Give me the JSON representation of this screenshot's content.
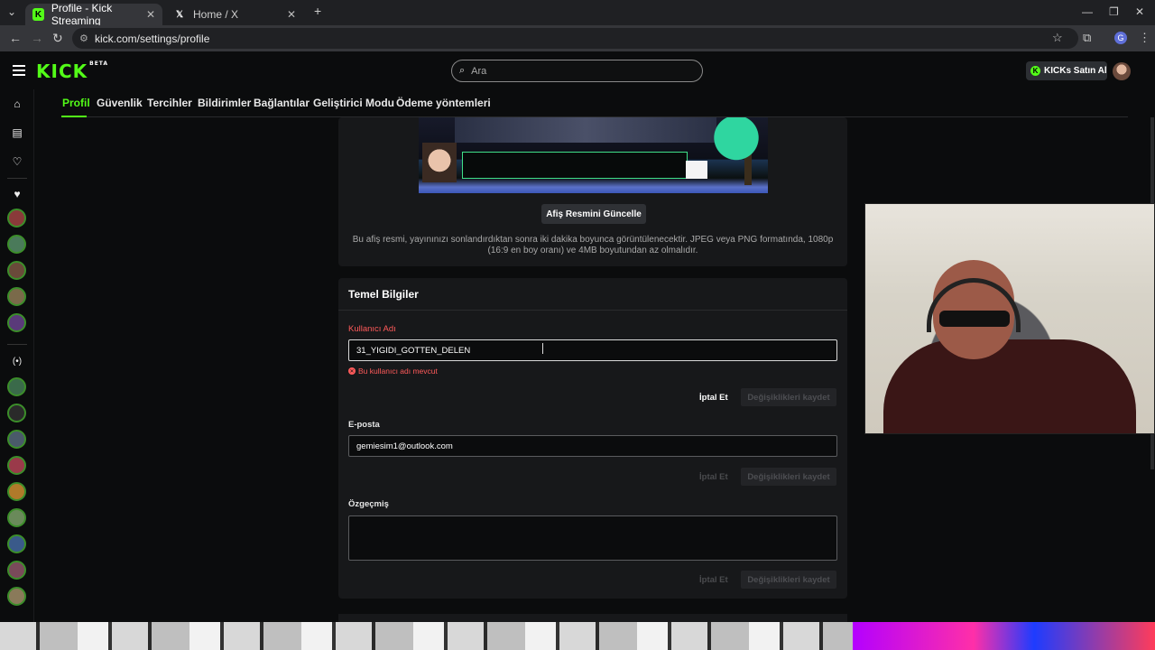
{
  "browser": {
    "tabs": [
      {
        "title": "Profile - Kick Streaming",
        "icon": "kick-icon",
        "active": true
      },
      {
        "title": "Home / X",
        "icon": "x-icon",
        "active": false
      }
    ],
    "new_tab": "+",
    "url": "kick.com/settings/profile",
    "profile_initial": "G"
  },
  "header": {
    "logo": "KICK",
    "logo_badge": "BETA",
    "search_placeholder": "Ara",
    "buy_label": "KICKs Satın Al"
  },
  "subnav": {
    "items": [
      "Profil",
      "Güvenlik",
      "Tercihler",
      "Bildirimler",
      "Bağlantılar",
      "Geliştirici Modu",
      "Ödeme yöntemleri"
    ],
    "active": "Profil"
  },
  "banner": {
    "update_label": "Afiş Resmini Güncelle",
    "note": "Bu afiş resmi, yayınınızı sonlandırdıktan sonra iki dakika boyunca görüntülenecektir. JPEG veya PNG formatında, 1080p (16:9 en boy oranı) ve 4MB boyutundan az olmalıdır."
  },
  "basic_info": {
    "title": "Temel Bilgiler",
    "username": {
      "label": "Kullanıcı Adı",
      "value": "31_YIGIDI_GOTTEN_DELEN",
      "error": "Bu kullanıcı adı mevcut"
    },
    "email": {
      "label": "E-posta",
      "value": "gemiesim1@outlook.com"
    },
    "bio": {
      "label": "Özgeçmiş",
      "value": ""
    },
    "cancel_label": "İptal Et",
    "save_label": "Değişiklikleri kaydet"
  },
  "colors": {
    "brand": "#53fc18",
    "error": "#ff5a5a"
  }
}
